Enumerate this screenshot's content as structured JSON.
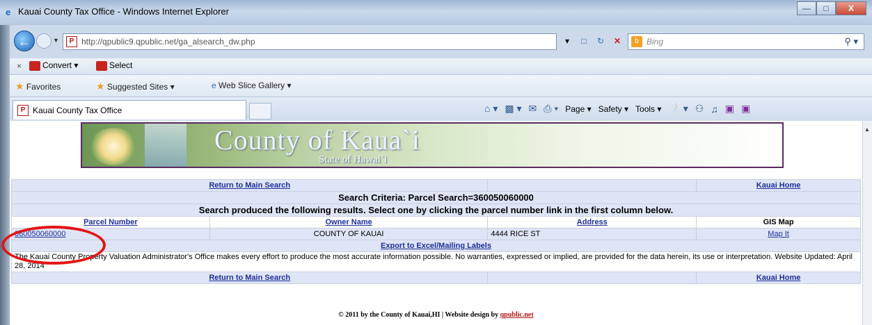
{
  "window": {
    "title": "Kauai County Tax Office - Windows Internet Explorer",
    "buttons": [
      "—",
      "□",
      "X"
    ]
  },
  "addressbar": {
    "url": "http://qpublic9.qpublic.net/ga_alsearch_dw.php",
    "search_placeholder": "Bing"
  },
  "commandbar": {
    "close": "×",
    "convert": "Convert",
    "select": "Select"
  },
  "favorites": {
    "label": "Favorites",
    "suggested": "Suggested Sites ▾",
    "webslice": "Web Slice Gallery ▾"
  },
  "tab": {
    "label": "Kauai County Tax Office"
  },
  "toolbar": {
    "page": "Page ▾",
    "safety": "Safety ▾",
    "tools": "Tools ▾"
  },
  "banner": {
    "title": "County of Kaua`i",
    "subtitle": "State of Hawai`i"
  },
  "results": {
    "return_link": "Return to Main Search",
    "home_link": "Kauai Home",
    "criteria": "Search Criteria: Parcel Search=360050060000",
    "produced": "Search produced the following results. Select one by clicking the parcel number link in the first column below.",
    "headers": {
      "parcel": "Parcel Number",
      "owner": "Owner Name",
      "address": "Address",
      "gis": "GIS Map"
    },
    "row": {
      "parcel": "360050060000",
      "owner": "COUNTY OF KAUAI",
      "address": "4444 RICE ST",
      "gis": "Map It"
    },
    "export": "Export to Excel/Mailing Labels",
    "disclaimer": "The Kauai County Property Valuation Administrator's Office makes every effort to produce the most accurate information possible. No warranties, expressed or implied, are provided for the data herein, its use or interpretation. Website Updated: April 28, 2014"
  },
  "footer": {
    "text": "© 2011 by the County of Kauai,HI | Website design by",
    "link": "qpublic.net"
  }
}
